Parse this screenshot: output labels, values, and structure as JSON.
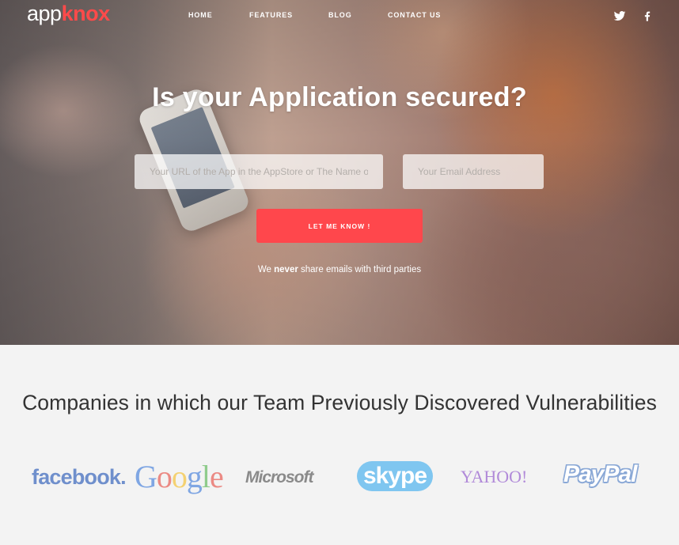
{
  "logo": {
    "part1": "app",
    "part2": "knox"
  },
  "nav": {
    "items": [
      {
        "label": "HOME"
      },
      {
        "label": "FEATURES"
      },
      {
        "label": "BLOG"
      },
      {
        "label": "CONTACT US"
      }
    ],
    "social": [
      {
        "icon": "twitter-icon"
      },
      {
        "icon": "facebook-icon"
      }
    ]
  },
  "hero": {
    "headline": "Is your Application secured?",
    "url_field": {
      "placeholder": "Your URL of the App in the AppStore or The Name of the App",
      "value": ""
    },
    "email_field": {
      "placeholder": "Your Email Address",
      "value": ""
    },
    "cta_label": "LET ME KNOW !",
    "disclaimer": {
      "before": "We ",
      "emphasis": "never",
      "after": " share emails with third parties"
    }
  },
  "companies": {
    "title": "Companies in which our Team Previously Discovered Vulnerabilities",
    "logos": [
      {
        "name": "facebook",
        "text": "facebook."
      },
      {
        "name": "google",
        "letters": [
          "G",
          "o",
          "o",
          "g",
          "l",
          "e"
        ]
      },
      {
        "name": "microsoft",
        "text": "Microsoft"
      },
      {
        "name": "skype",
        "text": "skype"
      },
      {
        "name": "yahoo",
        "text": "YAHOO!"
      },
      {
        "name": "paypal",
        "text": "PayPal"
      }
    ]
  },
  "colors": {
    "accent": "#ff474c",
    "logo_accent": "#ff4a4a",
    "section_background": "#f3f3f3",
    "heading_text": "#333333"
  }
}
